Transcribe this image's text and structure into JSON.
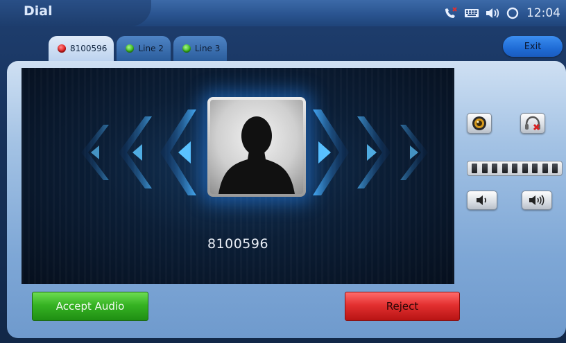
{
  "header": {
    "title": "Dial",
    "clock": "12:04",
    "status_icons": [
      "missed-call-icon",
      "keyboard-icon",
      "speaker-icon",
      "sync-icon"
    ]
  },
  "tabs": [
    {
      "label": "8100596",
      "status": "red",
      "active": true
    },
    {
      "label": "Line 2",
      "status": "green",
      "active": false
    },
    {
      "label": "Line 3",
      "status": "green",
      "active": false
    }
  ],
  "exit_label": "Exit",
  "call": {
    "caller_number": "8100596",
    "avatar": "contact-silhouette-icon"
  },
  "controls": {
    "camera": "camera-icon",
    "headset_mute": "headset-muted-icon",
    "volume_segments": 9,
    "volume_down": "volume-down-icon",
    "volume_up": "volume-up-icon"
  },
  "actions": {
    "accept_label": "Accept Audio",
    "reject_label": "Reject"
  },
  "colors": {
    "accept": "#36b323",
    "reject": "#e33030",
    "accent": "#1f6cd6"
  }
}
